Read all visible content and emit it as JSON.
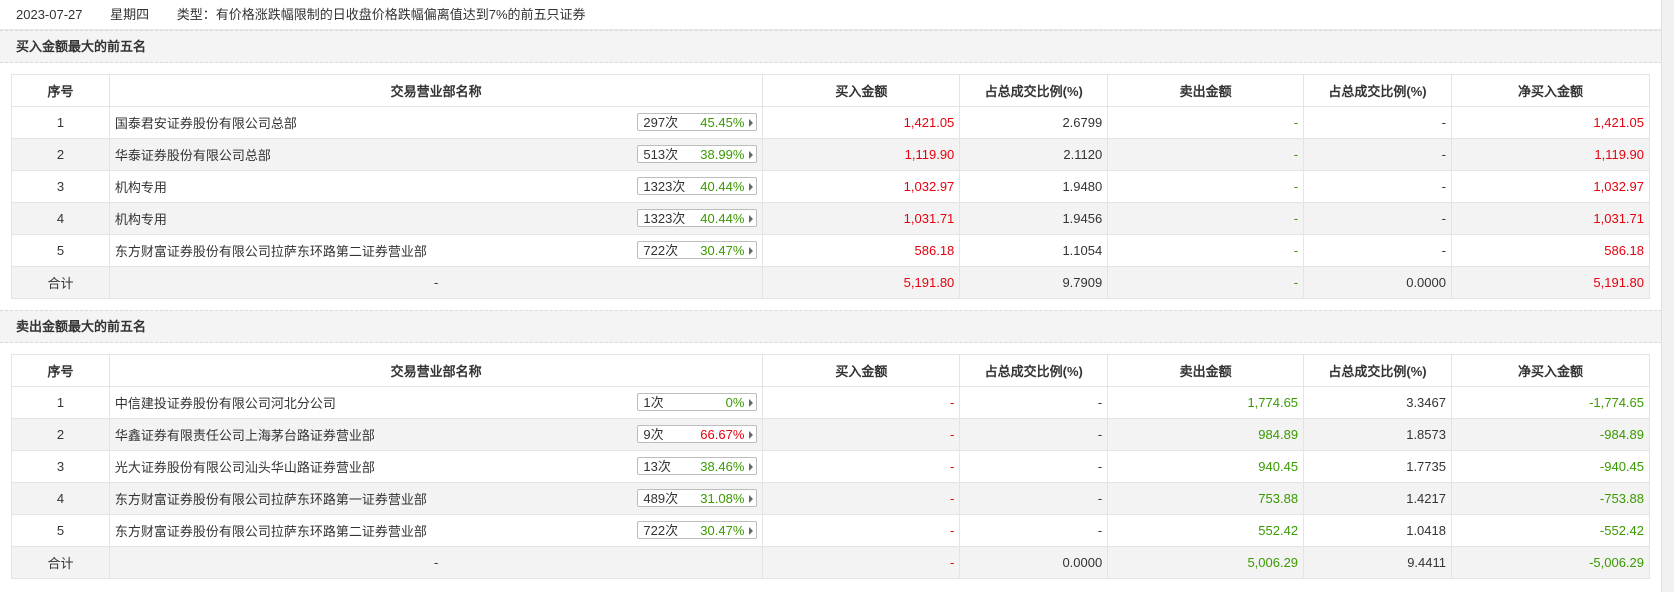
{
  "header": {
    "date": "2023-07-27",
    "weekday": "星期四",
    "type": "类型：有价格涨跌幅限制的日收盘价格跌幅偏离值达到7%的前五只证券"
  },
  "columns": [
    "序号",
    "交易营业部名称",
    "买入金额",
    "占总成交比例(%)",
    "卖出金额",
    "占总成交比例(%)",
    "净买入金额"
  ],
  "buy": {
    "title": "买入金额最大的前五名",
    "rows": [
      {
        "no": "1",
        "name": "国泰君安证券股份有限公司总部",
        "cnt": "297次",
        "pct": "45.45%",
        "pct_color": "green",
        "buy": "1,421.05",
        "buy_ratio": "2.6799",
        "sell": "-",
        "sell_ratio": "-",
        "net": "1,421.05"
      },
      {
        "no": "2",
        "name": "华泰证券股份有限公司总部",
        "cnt": "513次",
        "pct": "38.99%",
        "pct_color": "green",
        "buy": "1,119.90",
        "buy_ratio": "2.1120",
        "sell": "-",
        "sell_ratio": "-",
        "net": "1,119.90"
      },
      {
        "no": "3",
        "name": "机构专用",
        "cnt": "1323次",
        "pct": "40.44%",
        "pct_color": "green",
        "buy": "1,032.97",
        "buy_ratio": "1.9480",
        "sell": "-",
        "sell_ratio": "-",
        "net": "1,032.97"
      },
      {
        "no": "4",
        "name": "机构专用",
        "cnt": "1323次",
        "pct": "40.44%",
        "pct_color": "green",
        "buy": "1,031.71",
        "buy_ratio": "1.9456",
        "sell": "-",
        "sell_ratio": "-",
        "net": "1,031.71"
      },
      {
        "no": "5",
        "name": "东方财富证券股份有限公司拉萨东环路第二证券营业部",
        "cnt": "722次",
        "pct": "30.47%",
        "pct_color": "green",
        "buy": "586.18",
        "buy_ratio": "1.1054",
        "sell": "-",
        "sell_ratio": "-",
        "net": "586.18"
      }
    ],
    "total": {
      "label": "合计",
      "name": "-",
      "buy": "5,191.80",
      "buy_ratio": "9.7909",
      "sell": "-",
      "sell_ratio": "0.0000",
      "net": "5,191.80"
    }
  },
  "sell": {
    "title": "卖出金额最大的前五名",
    "rows": [
      {
        "no": "1",
        "name": "中信建投证券股份有限公司河北分公司",
        "cnt": "1次",
        "pct": "0%",
        "pct_color": "green",
        "buy": "-",
        "buy_ratio": "-",
        "sell": "1,774.65",
        "sell_ratio": "3.3467",
        "net": "-1,774.65"
      },
      {
        "no": "2",
        "name": "华鑫证券有限责任公司上海茅台路证券营业部",
        "cnt": "9次",
        "pct": "66.67%",
        "pct_color": "red",
        "buy": "-",
        "buy_ratio": "-",
        "sell": "984.89",
        "sell_ratio": "1.8573",
        "net": "-984.89"
      },
      {
        "no": "3",
        "name": "光大证券股份有限公司汕头华山路证券营业部",
        "cnt": "13次",
        "pct": "38.46%",
        "pct_color": "green",
        "buy": "-",
        "buy_ratio": "-",
        "sell": "940.45",
        "sell_ratio": "1.7735",
        "net": "-940.45"
      },
      {
        "no": "4",
        "name": "东方财富证券股份有限公司拉萨东环路第一证券营业部",
        "cnt": "489次",
        "pct": "31.08%",
        "pct_color": "green",
        "buy": "-",
        "buy_ratio": "-",
        "sell": "753.88",
        "sell_ratio": "1.4217",
        "net": "-753.88"
      },
      {
        "no": "5",
        "name": "东方财富证券股份有限公司拉萨东环路第二证券营业部",
        "cnt": "722次",
        "pct": "30.47%",
        "pct_color": "green",
        "buy": "-",
        "buy_ratio": "-",
        "sell": "552.42",
        "sell_ratio": "1.0418",
        "net": "-552.42"
      }
    ],
    "total": {
      "label": "合计",
      "name": "-",
      "buy": "-",
      "buy_ratio": "0.0000",
      "sell": "5,006.29",
      "sell_ratio": "9.4411",
      "net": "-5,006.29"
    }
  },
  "colors": {
    "red": "#e5000e",
    "green": "#3a9a00",
    "section_bg": "#f4f4f4"
  }
}
